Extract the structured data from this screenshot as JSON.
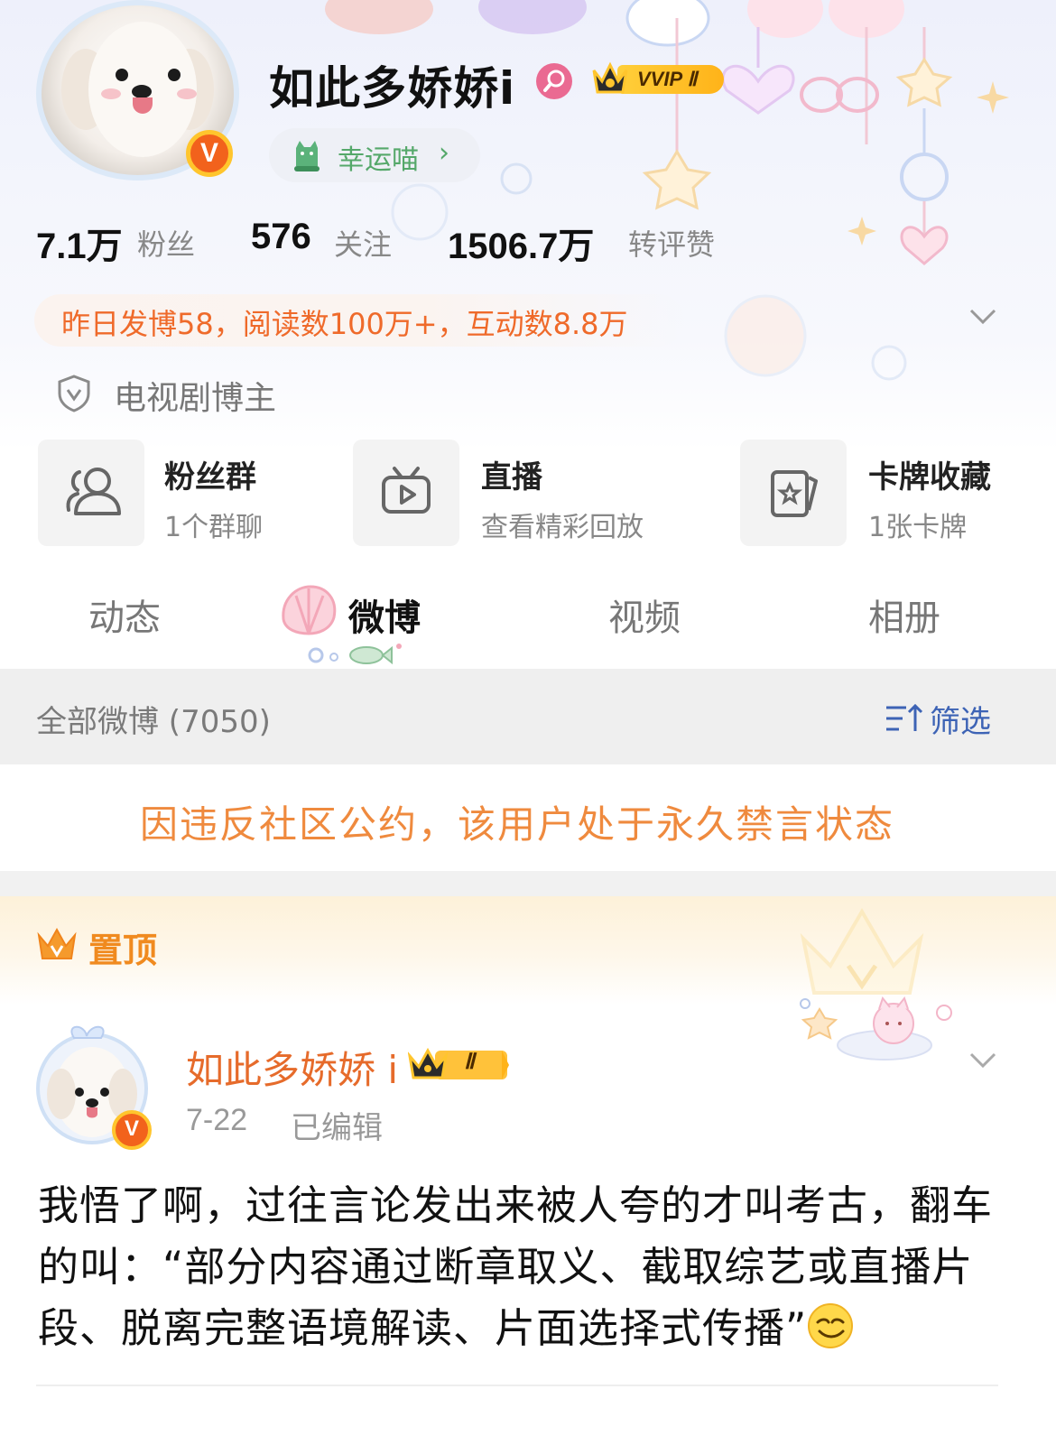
{
  "profile": {
    "name": "如此多娇娇i",
    "vip_label": "VVIP Ⅱ",
    "verified_badge": "V",
    "lucky_label": "幸运喵",
    "lucky_arrow": "›"
  },
  "stats": [
    {
      "value": "7.1万",
      "label": "粉丝"
    },
    {
      "value": "576",
      "label": "关注"
    },
    {
      "value": "1506.7万",
      "label": "转评赞"
    }
  ],
  "summary": "昨日发博58，阅读数100万+，互动数8.8万",
  "role": "电视剧博主",
  "cards": [
    {
      "title": "粉丝群",
      "subtitle": "1个群聊",
      "icon": "people-icon"
    },
    {
      "title": "直播",
      "subtitle": "查看精彩回放",
      "icon": "tv-icon"
    },
    {
      "title": "卡牌收藏",
      "subtitle": "1张卡牌",
      "icon": "card-icon"
    }
  ],
  "tabs": [
    {
      "label": "动态",
      "active": false
    },
    {
      "label": "微博",
      "active": true
    },
    {
      "label": "视频",
      "active": false
    },
    {
      "label": "相册",
      "active": false
    }
  ],
  "filter": {
    "left": "全部微博 (7050)",
    "right": "筛选"
  },
  "ban_notice": "因违反社区公约，该用户处于永久禁言状态",
  "pinned_label": "置顶",
  "post": {
    "author": "如此多娇娇 i",
    "badge_label": "Ⅱ",
    "date": "7-22",
    "edited": "已编辑",
    "text": "我悟了啊，过往言论发出来被人夸的才叫考古，翻车的叫：“部分内容通过断章取义、截取综艺或直播片段、脱离完整语境解读、片面选择式传播”"
  },
  "colors": {
    "accent_orange": "#ef6a2a",
    "link_blue": "#3d63b5",
    "lucky_green": "#55a86a",
    "vip_gold": "#ffb319"
  }
}
